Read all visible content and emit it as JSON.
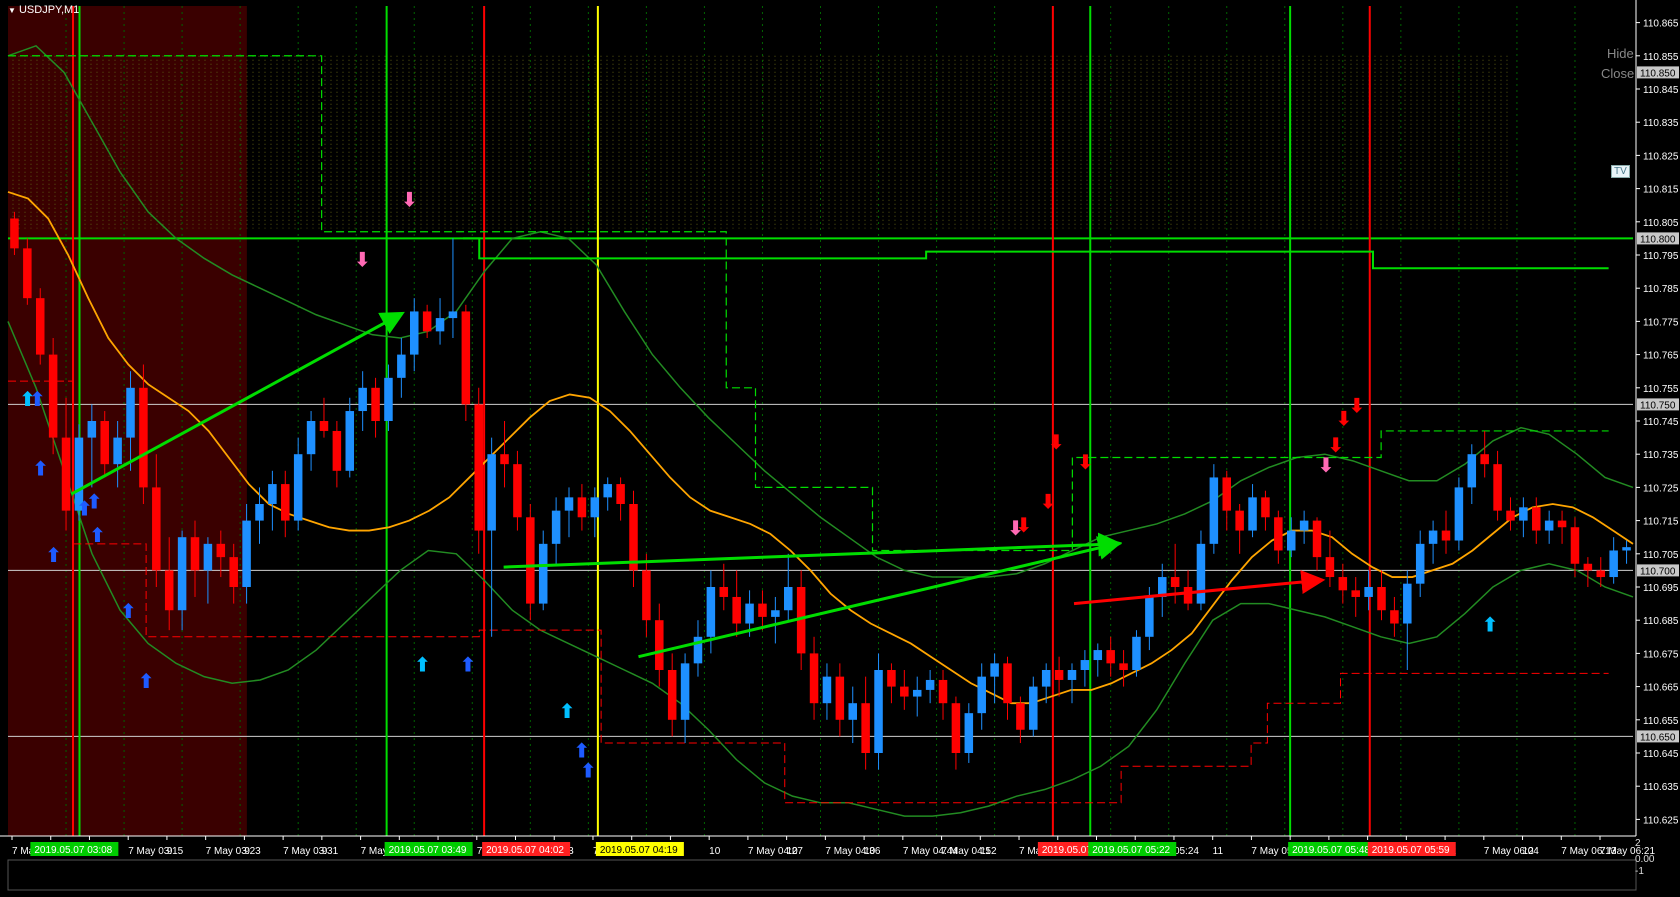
{
  "window": {
    "symbol_label": "USDJPY,M1",
    "collapse_icon": "triangle-down-icon"
  },
  "side_text": {
    "hide": "Hide",
    "close": "Close",
    "tv": "TV",
    "sub_top": "2",
    "sub_mid": "0.00",
    "sub_bot": "-1"
  },
  "colors": {
    "background": "#000000",
    "bull": "#1E90FF",
    "bear": "#FF0000",
    "grid": "#006400",
    "green_line": "#00DD00",
    "red_line": "#FF0000",
    "yellow_line": "#FFFF00",
    "ma": "#FFA500",
    "band": "#228B22",
    "session_fill": "#3A0000",
    "accent_arrow_up": "#00BFFF",
    "accent_arrow_down": "#FF0000"
  },
  "chart_data": {
    "type": "candlestick",
    "symbol": "USDJPY",
    "timeframe": "M1",
    "ylim": [
      110.62,
      110.87
    ],
    "y_ticks": [
      110.865,
      110.855,
      110.845,
      110.835,
      110.825,
      110.815,
      110.805,
      110.795,
      110.785,
      110.775,
      110.765,
      110.755,
      110.745,
      110.735,
      110.725,
      110.715,
      110.705,
      110.695,
      110.685,
      110.675,
      110.665,
      110.655,
      110.645,
      110.635,
      110.625
    ],
    "price_tags": [
      110.85,
      110.8,
      110.75,
      110.7,
      110.65
    ],
    "horizontal_levels": [
      110.8,
      110.75,
      110.7,
      110.65
    ],
    "x_labels": [
      "7 May",
      "9",
      "9",
      "7 May 03:15",
      "9",
      "7 May 03:23",
      "9",
      "7 May 03:31",
      "9",
      "7 May 03",
      "9",
      "10",
      "7 M",
      "10",
      "4:03",
      "7 May",
      "10",
      "19",
      "10",
      "7 May 04:27",
      "10",
      "7 May 04:36",
      "10",
      "7 May 04:44",
      "7 May 04:52",
      "11",
      "7 May 05:00",
      "11",
      "7 May 0",
      "11",
      "05:24",
      "11",
      "7 May 05:32",
      "11",
      "7 May",
      "11",
      "4",
      "12",
      "7 May 06:04",
      "12",
      "7 May 06:13",
      "7 May 06:21"
    ],
    "time_markers": [
      {
        "label": "2019.05.07 03:08",
        "color": "green"
      },
      {
        "label": "2019.05.07 03:49",
        "color": "green"
      },
      {
        "label": "2019.05.07 04:02",
        "color": "red"
      },
      {
        "label": "2019.05.07 04:19",
        "color": "yellow"
      },
      {
        "label": "2019.05.07 05:22",
        "color": "red"
      },
      {
        "label": "2019.05.07 05:22",
        "color": "green"
      },
      {
        "label": "2019.05.07 05:48",
        "color": "green"
      },
      {
        "label": "2019.05.07 05:59",
        "color": "red"
      }
    ],
    "candles": [
      [
        110.806,
        110.808,
        110.795,
        110.797
      ],
      [
        110.797,
        110.8,
        110.78,
        110.782
      ],
      [
        110.782,
        110.785,
        110.762,
        110.765
      ],
      [
        110.765,
        110.77,
        110.735,
        110.74
      ],
      [
        110.74,
        110.752,
        110.712,
        110.718
      ],
      [
        110.718,
        110.744,
        110.715,
        110.74
      ],
      [
        110.74,
        110.75,
        110.725,
        110.745
      ],
      [
        110.745,
        110.748,
        110.728,
        110.732
      ],
      [
        110.732,
        110.745,
        110.725,
        110.74
      ],
      [
        110.74,
        110.76,
        110.73,
        110.755
      ],
      [
        110.755,
        110.762,
        110.72,
        110.725
      ],
      [
        110.725,
        110.735,
        110.695,
        110.7
      ],
      [
        110.7,
        110.71,
        110.682,
        110.688
      ],
      [
        110.688,
        110.712,
        110.682,
        110.71
      ],
      [
        110.71,
        110.715,
        110.692,
        110.7
      ],
      [
        110.7,
        110.71,
        110.69,
        110.708
      ],
      [
        110.708,
        110.712,
        110.698,
        110.704
      ],
      [
        110.704,
        110.708,
        110.69,
        110.695
      ],
      [
        110.695,
        110.72,
        110.69,
        110.715
      ],
      [
        110.715,
        110.725,
        110.708,
        110.72
      ],
      [
        110.72,
        110.73,
        110.712,
        110.726
      ],
      [
        110.726,
        110.73,
        110.71,
        110.715
      ],
      [
        110.715,
        110.74,
        110.712,
        110.735
      ],
      [
        110.735,
        110.748,
        110.73,
        110.745
      ],
      [
        110.745,
        110.752,
        110.74,
        110.742
      ],
      [
        110.742,
        110.745,
        110.725,
        110.73
      ],
      [
        110.73,
        110.752,
        110.728,
        110.748
      ],
      [
        110.748,
        110.76,
        110.742,
        110.755
      ],
      [
        110.755,
        110.758,
        110.74,
        110.745
      ],
      [
        110.745,
        110.762,
        110.742,
        110.758
      ],
      [
        110.758,
        110.77,
        110.752,
        110.765
      ],
      [
        110.765,
        110.782,
        110.76,
        110.778
      ],
      [
        110.778,
        110.78,
        110.77,
        110.772
      ],
      [
        110.772,
        110.782,
        110.768,
        110.776
      ],
      [
        110.776,
        110.8,
        110.77,
        110.778
      ],
      [
        110.778,
        110.78,
        110.745,
        110.75
      ],
      [
        110.75,
        110.755,
        110.705,
        110.712
      ],
      [
        110.712,
        110.74,
        110.68,
        110.735
      ],
      [
        110.735,
        110.745,
        110.725,
        110.732
      ],
      [
        110.732,
        110.736,
        110.712,
        110.716
      ],
      [
        110.716,
        110.72,
        110.685,
        110.69
      ],
      [
        110.69,
        110.712,
        110.688,
        110.708
      ],
      [
        110.708,
        110.722,
        110.702,
        110.718
      ],
      [
        110.718,
        110.725,
        110.71,
        110.722
      ],
      [
        110.722,
        110.726,
        110.712,
        110.716
      ],
      [
        110.716,
        110.725,
        110.71,
        110.722
      ],
      [
        110.722,
        110.728,
        110.718,
        110.726
      ],
      [
        110.726,
        110.728,
        110.715,
        110.72
      ],
      [
        110.72,
        110.724,
        110.695,
        110.7
      ],
      [
        110.7,
        110.705,
        110.68,
        110.685
      ],
      [
        110.685,
        110.69,
        110.665,
        110.67
      ],
      [
        110.67,
        110.675,
        110.65,
        110.655
      ],
      [
        110.655,
        110.675,
        110.648,
        110.672
      ],
      [
        110.672,
        110.685,
        110.668,
        110.68
      ],
      [
        110.68,
        110.7,
        110.675,
        110.695
      ],
      [
        110.695,
        110.702,
        110.688,
        110.692
      ],
      [
        110.692,
        110.7,
        110.68,
        110.684
      ],
      [
        110.684,
        110.694,
        110.68,
        110.69
      ],
      [
        110.69,
        110.694,
        110.682,
        110.686
      ],
      [
        110.686,
        110.692,
        110.678,
        110.688
      ],
      [
        110.688,
        110.705,
        110.685,
        110.695
      ],
      [
        110.695,
        110.7,
        110.67,
        110.675
      ],
      [
        110.675,
        110.68,
        110.655,
        110.66
      ],
      [
        110.66,
        110.672,
        110.655,
        110.668
      ],
      [
        110.668,
        110.672,
        110.65,
        110.655
      ],
      [
        110.655,
        110.665,
        110.648,
        110.66
      ],
      [
        110.66,
        110.668,
        110.64,
        110.645
      ],
      [
        110.645,
        110.675,
        110.64,
        110.67
      ],
      [
        110.67,
        110.672,
        110.66,
        110.665
      ],
      [
        110.665,
        110.67,
        110.658,
        110.662
      ],
      [
        110.662,
        110.668,
        110.656,
        110.664
      ],
      [
        110.664,
        110.67,
        110.66,
        110.667
      ],
      [
        110.667,
        110.67,
        110.655,
        110.66
      ],
      [
        110.66,
        110.662,
        110.64,
        110.645
      ],
      [
        110.645,
        110.66,
        110.642,
        110.657
      ],
      [
        110.657,
        110.672,
        110.652,
        110.668
      ],
      [
        110.668,
        110.675,
        110.66,
        110.672
      ],
      [
        110.672,
        110.674,
        110.655,
        110.66
      ],
      [
        110.66,
        110.662,
        110.648,
        110.652
      ],
      [
        110.652,
        110.668,
        110.65,
        110.665
      ],
      [
        110.665,
        110.672,
        110.66,
        110.67
      ],
      [
        110.67,
        110.674,
        110.662,
        110.667
      ],
      [
        110.667,
        110.672,
        110.66,
        110.67
      ],
      [
        110.67,
        110.676,
        110.665,
        110.673
      ],
      [
        110.673,
        110.678,
        110.668,
        110.676
      ],
      [
        110.676,
        110.68,
        110.668,
        110.672
      ],
      [
        110.672,
        110.676,
        110.665,
        110.67
      ],
      [
        110.67,
        110.682,
        110.668,
        110.68
      ],
      [
        110.68,
        110.695,
        110.676,
        110.692
      ],
      [
        110.692,
        110.702,
        110.686,
        110.698
      ],
      [
        110.698,
        110.708,
        110.69,
        110.695
      ],
      [
        110.695,
        110.7,
        110.688,
        110.69
      ],
      [
        110.69,
        110.712,
        110.688,
        110.708
      ],
      [
        110.708,
        110.732,
        110.705,
        110.728
      ],
      [
        110.728,
        110.73,
        110.712,
        110.718
      ],
      [
        110.718,
        110.72,
        110.705,
        110.712
      ],
      [
        110.712,
        110.726,
        110.71,
        110.722
      ],
      [
        110.722,
        110.724,
        110.712,
        110.716
      ],
      [
        110.716,
        110.718,
        110.702,
        110.706
      ],
      [
        110.706,
        110.716,
        110.704,
        110.712
      ],
      [
        110.712,
        110.718,
        110.708,
        110.715
      ],
      [
        110.715,
        110.716,
        110.7,
        110.704
      ],
      [
        110.704,
        110.712,
        110.695,
        110.698
      ],
      [
        110.698,
        110.702,
        110.69,
        110.694
      ],
      [
        110.694,
        110.698,
        110.686,
        110.692
      ],
      [
        110.692,
        110.7,
        110.688,
        110.695
      ],
      [
        110.695,
        110.7,
        110.685,
        110.688
      ],
      [
        110.688,
        110.692,
        110.68,
        110.684
      ],
      [
        110.684,
        110.7,
        110.67,
        110.696
      ],
      [
        110.696,
        110.712,
        110.692,
        110.708
      ],
      [
        110.708,
        110.715,
        110.702,
        110.712
      ],
      [
        110.712,
        110.718,
        110.705,
        110.709
      ],
      [
        110.709,
        110.728,
        110.706,
        110.725
      ],
      [
        110.725,
        110.738,
        110.72,
        110.735
      ],
      [
        110.735,
        110.742,
        110.728,
        110.732
      ],
      [
        110.732,
        110.736,
        110.715,
        110.718
      ],
      [
        110.718,
        110.722,
        110.712,
        110.715
      ],
      [
        110.715,
        110.722,
        110.71,
        110.719
      ],
      [
        110.719,
        110.722,
        110.708,
        110.712
      ],
      [
        110.712,
        110.718,
        110.708,
        110.715
      ],
      [
        110.715,
        110.718,
        110.708,
        110.713
      ],
      [
        110.713,
        110.716,
        110.698,
        110.702
      ],
      [
        110.702,
        110.704,
        110.695,
        110.7
      ],
      [
        110.7,
        110.704,
        110.695,
        110.698
      ],
      [
        110.698,
        110.71,
        110.696,
        110.706
      ],
      [
        110.706,
        110.709,
        110.702,
        110.707
      ]
    ],
    "ma_series": [
      110.814,
      110.812,
      110.806,
      110.795,
      110.782,
      110.77,
      110.762,
      110.756,
      110.752,
      110.748,
      110.742,
      110.734,
      110.726,
      110.72,
      110.717,
      110.715,
      110.713,
      110.712,
      110.712,
      110.713,
      110.715,
      110.718,
      110.722,
      110.728,
      110.734,
      110.74,
      110.746,
      110.751,
      110.753,
      110.752,
      110.748,
      110.742,
      110.735,
      110.728,
      110.722,
      110.718,
      110.716,
      110.714,
      110.711,
      110.706,
      110.7,
      110.693,
      110.688,
      110.684,
      110.681,
      110.678,
      110.674,
      110.67,
      110.666,
      110.663,
      110.66,
      110.66,
      110.662,
      110.664,
      110.664,
      110.666,
      110.669,
      110.672,
      110.676,
      110.681,
      110.689,
      110.697,
      110.704,
      110.709,
      110.712,
      110.712,
      110.71,
      110.705,
      110.701,
      110.698,
      110.698,
      110.7,
      110.702,
      110.706,
      110.711,
      110.716,
      110.719,
      110.72,
      110.719,
      110.716,
      110.712,
      110.708
    ],
    "band_upper": [
      110.855,
      110.858,
      110.85,
      110.835,
      110.82,
      110.808,
      110.8,
      110.794,
      110.789,
      110.785,
      110.781,
      110.777,
      110.774,
      110.771,
      110.77,
      110.772,
      110.778,
      110.79,
      110.8,
      110.802,
      110.8,
      110.792,
      110.778,
      110.765,
      110.755,
      110.746,
      110.738,
      110.73,
      110.723,
      110.716,
      110.71,
      110.704,
      110.7,
      110.698,
      110.698,
      110.698,
      110.699,
      110.702,
      110.706,
      110.71,
      110.712,
      110.714,
      110.717,
      110.721,
      110.727,
      110.731,
      110.734,
      110.735,
      110.733,
      110.73,
      110.727,
      110.727,
      110.732,
      110.739,
      110.743,
      110.741,
      110.735,
      110.728,
      110.725
    ],
    "band_lower": [
      110.775,
      110.755,
      110.73,
      110.705,
      110.688,
      110.678,
      110.672,
      110.668,
      110.666,
      110.667,
      110.67,
      110.676,
      110.684,
      110.692,
      110.7,
      110.706,
      110.705,
      110.697,
      110.688,
      110.682,
      110.678,
      110.674,
      110.67,
      110.666,
      110.66,
      110.652,
      110.643,
      110.636,
      110.632,
      110.63,
      110.63,
      110.628,
      110.626,
      110.626,
      110.627,
      110.629,
      110.632,
      110.634,
      110.637,
      110.641,
      110.647,
      110.658,
      110.672,
      110.685,
      110.69,
      110.69,
      110.688,
      110.686,
      110.683,
      110.68,
      110.678,
      110.68,
      110.687,
      110.695,
      110.7,
      110.702,
      110.7,
      110.695,
      110.692
    ],
    "trend_arrows": [
      {
        "from": [
          0.039,
          110.723
        ],
        "to": [
          0.241,
          110.777
        ],
        "color": "green"
      },
      {
        "from": [
          0.305,
          110.701
        ],
        "to": [
          0.682,
          110.708
        ],
        "color": "green"
      },
      {
        "from": [
          0.388,
          110.674
        ],
        "to": [
          0.682,
          110.708
        ],
        "color": "green"
      },
      {
        "from": [
          0.656,
          110.69
        ],
        "to": [
          0.807,
          110.697
        ],
        "color": "red"
      }
    ]
  }
}
